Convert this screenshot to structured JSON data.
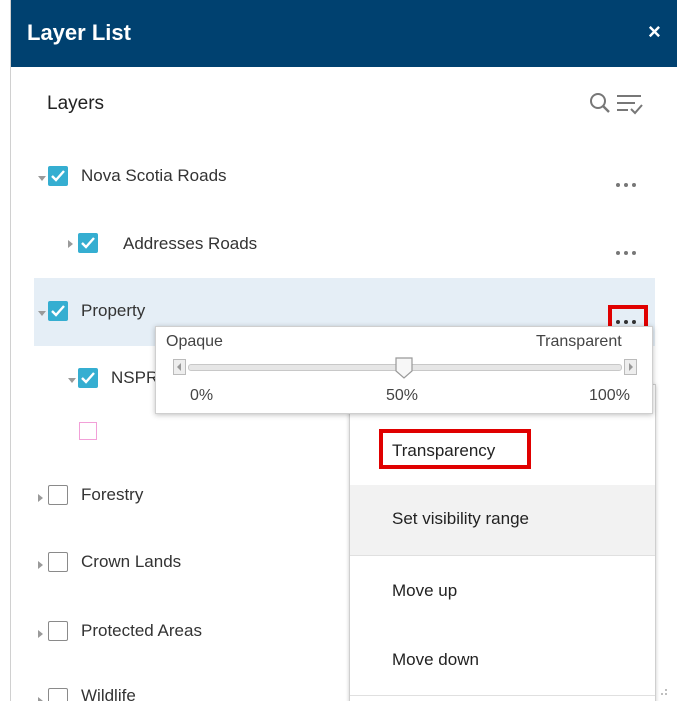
{
  "header": {
    "title": "Layer List",
    "close_label": "×"
  },
  "toolbar": {
    "layers_label": "Layers",
    "search_icon": "search-icon",
    "filter_icon": "filter-sort-icon"
  },
  "layers": [
    {
      "name": "Nova Scotia Roads",
      "checked": true
    },
    {
      "name": "Addresses Roads",
      "checked": true
    },
    {
      "name": "Property",
      "checked": true
    },
    {
      "name": "NSPRD",
      "checked": true
    },
    {
      "name": "Forestry",
      "checked": false
    },
    {
      "name": "Crown Lands",
      "checked": false
    },
    {
      "name": "Protected Areas",
      "checked": false
    },
    {
      "name": "Wildlife",
      "checked": false
    }
  ],
  "transparency": {
    "left_label": "Opaque",
    "right_label": "Transparent",
    "ticks": [
      "0%",
      "50%",
      "100%"
    ],
    "value": 0.5
  },
  "menu": {
    "items": [
      "Transparency",
      "Set visibility range",
      "Move up",
      "Move down"
    ]
  },
  "colors": {
    "header": "#004170",
    "checkbox": "#35aed1",
    "highlight": "#e5eef6",
    "annotation": "#e00000"
  }
}
